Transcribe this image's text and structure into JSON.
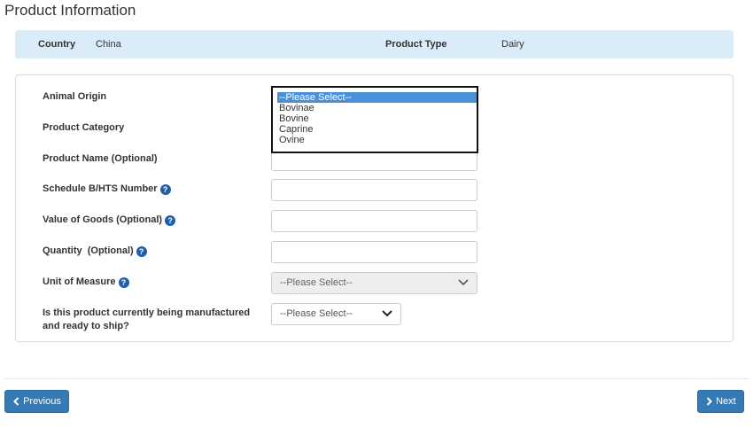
{
  "page": {
    "title": "Product Information"
  },
  "summary": {
    "country_label": "Country",
    "country_value": "China",
    "product_type_label": "Product Type",
    "product_type_value": "Dairy"
  },
  "form": {
    "animal_origin": {
      "label": "Animal Origin",
      "options": [
        "--Please Select--",
        "Bovinae",
        "Bovine",
        "Caprine",
        "Ovine"
      ],
      "selected": "--Please Select--"
    },
    "product_category": {
      "label": "Product Category"
    },
    "product_name": {
      "label": "Product Name (Optional)",
      "value": ""
    },
    "hts_number": {
      "label": "Schedule B/HTS Number",
      "value": "",
      "help_icon": "question-circle-icon"
    },
    "value_of_goods": {
      "label": "Value of Goods (Optional)",
      "value": "",
      "help_icon": "question-circle-icon"
    },
    "quantity": {
      "label": "Quantity  (Optional)",
      "value": "",
      "help_icon": "question-circle-icon"
    },
    "unit_of_measure": {
      "label": "Unit of Measure",
      "value": "--Please Select--",
      "help_icon": "question-circle-icon",
      "disabled": true
    },
    "manufactured": {
      "label_line1": "Is this product currently being manufactured",
      "label_line2": "and ready to ship?",
      "value": "--Please Select--"
    }
  },
  "navigation": {
    "previous_label": "Previous",
    "next_label": "Next"
  },
  "colors": {
    "summary_bg": "#d9ecf7",
    "button_primary": "#337ab7",
    "help_icon": "#1e5fa8",
    "selected_option": "#4a90d9"
  }
}
